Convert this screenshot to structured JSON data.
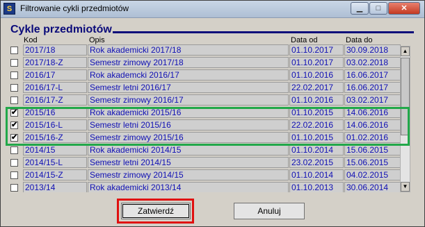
{
  "window": {
    "title": "Filtrowanie cykli przedmiotów",
    "icon_label": "S"
  },
  "section_title": "Cykle przedmiotów",
  "columns": [
    "Kod",
    "Opis",
    "Data od",
    "Data do"
  ],
  "rows": [
    {
      "checked": false,
      "kod": "2017/18",
      "opis": "Rok akademicki 2017/18",
      "od": "01.10.2017",
      "do": "30.09.2018"
    },
    {
      "checked": false,
      "kod": "2017/18-Z",
      "opis": "Semestr zimowy 2017/18",
      "od": "01.10.2017",
      "do": "03.02.2018"
    },
    {
      "checked": false,
      "kod": "2016/17",
      "opis": "Rok akademcki 2016/17",
      "od": "01.10.2016",
      "do": "16.06.2017"
    },
    {
      "checked": false,
      "kod": "2016/17-L",
      "opis": "Semestr letni 2016/17",
      "od": "22.02.2017",
      "do": "16.06.2017"
    },
    {
      "checked": false,
      "kod": "2016/17-Z",
      "opis": "Semestr zimowy 2016/17",
      "od": "01.10.2016",
      "do": "03.02.2017"
    },
    {
      "checked": true,
      "kod": "2015/16",
      "opis": "Rok akademicki 2015/16",
      "od": "01.10.2015",
      "do": "14.06.2016"
    },
    {
      "checked": true,
      "kod": "2015/16-L",
      "opis": "Semestr letni 2015/16",
      "od": "22.02.2016",
      "do": "14.06.2016"
    },
    {
      "checked": true,
      "kod": "2015/16-Z",
      "opis": "Semestr zimowy 2015/16",
      "od": "01.10.2015",
      "do": "01.02.2016"
    },
    {
      "checked": false,
      "kod": "2014/15",
      "opis": "Rok akademicki 2014/15",
      "od": "01.10.2014",
      "do": "15.06.2015"
    },
    {
      "checked": false,
      "kod": "2014/15-L",
      "opis": "Semestr letni 2014/15",
      "od": "23.02.2015",
      "do": "15.06.2015"
    },
    {
      "checked": false,
      "kod": "2014/15-Z",
      "opis": "Semestr zimowy 2014/15",
      "od": "01.10.2014",
      "do": "04.02.2015"
    },
    {
      "checked": false,
      "kod": "2013/14",
      "opis": "Rok akademicki 2013/14",
      "od": "01.10.2013",
      "do": "30.06.2014"
    }
  ],
  "buttons": {
    "confirm": "Zatwierdź",
    "cancel": "Anuluj"
  },
  "colors": {
    "highlight_selected": "#22a84a",
    "highlight_button": "#e01010",
    "cell_text": "#1010b4",
    "section_title": "#0b0b7a"
  }
}
